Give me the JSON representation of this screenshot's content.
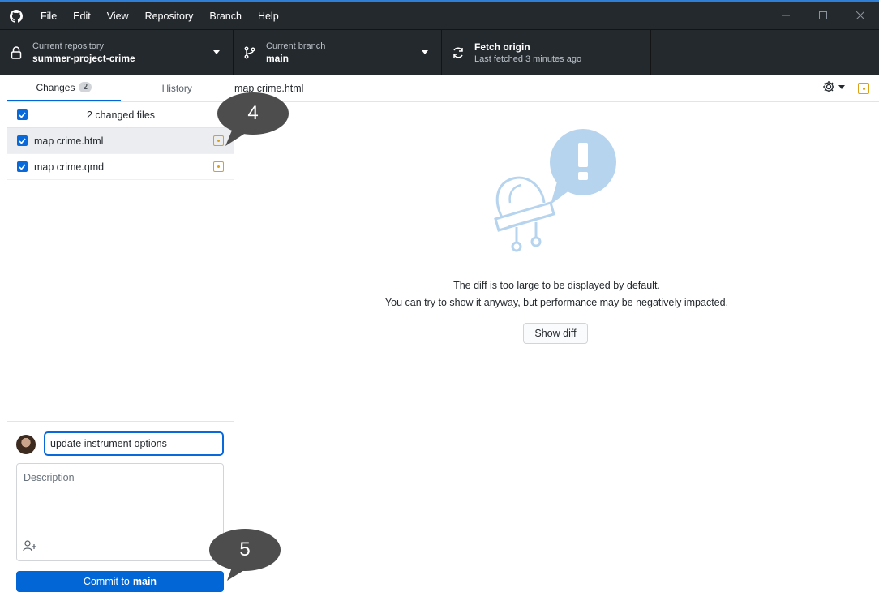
{
  "menu": [
    "File",
    "Edit",
    "View",
    "Repository",
    "Branch",
    "Help"
  ],
  "toolbar": {
    "repo_label": "Current repository",
    "repo_value": "summer-project-crime",
    "branch_label": "Current branch",
    "branch_value": "main",
    "fetch_title": "Fetch origin",
    "fetch_sub": "Last fetched 3 minutes ago"
  },
  "tabs": {
    "changes_label": "Changes",
    "changes_count": "2",
    "history_label": "History"
  },
  "changes": {
    "header": "2 changed files",
    "files": [
      {
        "name": "map crime.html"
      },
      {
        "name": "map crime.qmd"
      }
    ]
  },
  "commit": {
    "summary_value": "update instrument options",
    "description_placeholder": "Description",
    "button_prefix": "Commit to",
    "button_branch": "main"
  },
  "main": {
    "path": "map crime.html",
    "message_line1": "The diff is too large to be displayed by default.",
    "message_line2": "You can try to show it anyway, but performance may be negatively impacted.",
    "show_diff_label": "Show diff"
  },
  "callouts": {
    "first": "4",
    "second": "5"
  },
  "colors": {
    "accent": "#0366d6",
    "titlebar": "#24292e",
    "modified": "#dba218"
  }
}
